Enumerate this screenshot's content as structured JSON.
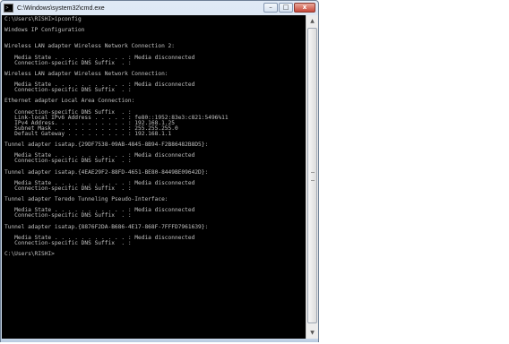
{
  "window": {
    "title": "C:\\Windows\\system32\\cmd.exe",
    "minimize_glyph": "–",
    "maximize_glyph": "□",
    "close_glyph": "x"
  },
  "console": {
    "lines": [
      "C:\\Users\\RISHI>ipconfig",
      "",
      "Windows IP Configuration",
      "",
      "",
      "Wireless LAN adapter Wireless Network Connection 2:",
      "",
      "   Media State . . . . . . . . . . . : Media disconnected",
      "   Connection-specific DNS Suffix  . :",
      "",
      "Wireless LAN adapter Wireless Network Connection:",
      "",
      "   Media State . . . . . . . . . . . : Media disconnected",
      "   Connection-specific DNS Suffix  . :",
      "",
      "Ethernet adapter Local Area Connection:",
      "",
      "   Connection-specific DNS Suffix  . :",
      "   Link-local IPv6 Address . . . . . : fe80::1952:83e3:c821:5496%11",
      "   IPv4 Address. . . . . . . . . . . : 192.168.1.25",
      "   Subnet Mask . . . . . . . . . . . : 255.255.255.0",
      "   Default Gateway . . . . . . . . . : 192.168.1.1",
      "",
      "Tunnel adapter isatap.{29DF7538-09AB-4845-8B94-F2B86482B8D5}:",
      "",
      "   Media State . . . . . . . . . . . : Media disconnected",
      "   Connection-specific DNS Suffix  . :",
      "",
      "Tunnel adapter isatap.{4EAE29F2-88FD-4651-BE80-8449BE09642D}:",
      "",
      "   Media State . . . . . . . . . . . : Media disconnected",
      "   Connection-specific DNS Suffix  . :",
      "",
      "Tunnel adapter Teredo Tunneling Pseudo-Interface:",
      "",
      "   Media State . . . . . . . . . . . : Media disconnected",
      "   Connection-specific DNS Suffix  . :",
      "",
      "Tunnel adapter isatap.{8876F2DA-B686-4E17-868F-7FFFD7961639}:",
      "",
      "   Media State . . . . . . . . . . . : Media disconnected",
      "   Connection-specific DNS Suffix  . :",
      "",
      "C:\\Users\\RISHI>"
    ]
  },
  "icons": {
    "app": "cmd-icon",
    "scroll_up": "▲",
    "scroll_down": "▼"
  },
  "colors": {
    "console_background": "#000000",
    "console_text": "#c0c0c0",
    "titlebar": "#dfe9f5",
    "close_button": "#c7483a"
  }
}
